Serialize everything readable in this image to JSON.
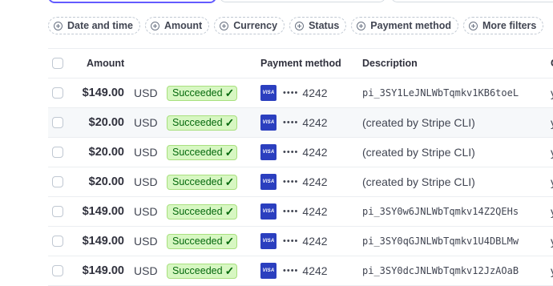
{
  "filters": [
    {
      "label": "Date and time",
      "name": "filter-date-and-time"
    },
    {
      "label": "Amount",
      "name": "filter-amount"
    },
    {
      "label": "Currency",
      "name": "filter-currency"
    },
    {
      "label": "Status",
      "name": "filter-status"
    },
    {
      "label": "Payment method",
      "name": "filter-payment-method"
    },
    {
      "label": "More filters",
      "name": "filter-more-filters"
    }
  ],
  "table": {
    "headers": {
      "amount": "Amount",
      "payment_method": "Payment method",
      "description": "Description",
      "next": "C"
    },
    "rows": [
      {
        "amount": "$149.00",
        "currency": "USD",
        "status": "Succeeded",
        "brand": "VISA",
        "dots": "••••",
        "last4": "4242",
        "description": "pi_3SY1LeJNLWbTqmkv1KB6toeL",
        "mono": true,
        "next": "y"
      },
      {
        "amount": "$20.00",
        "currency": "USD",
        "status": "Succeeded",
        "brand": "VISA",
        "dots": "••••",
        "last4": "4242",
        "description": "(created by Stripe CLI)",
        "mono": false,
        "next": "y"
      },
      {
        "amount": "$20.00",
        "currency": "USD",
        "status": "Succeeded",
        "brand": "VISA",
        "dots": "••••",
        "last4": "4242",
        "description": "(created by Stripe CLI)",
        "mono": false,
        "next": "y"
      },
      {
        "amount": "$20.00",
        "currency": "USD",
        "status": "Succeeded",
        "brand": "VISA",
        "dots": "••••",
        "last4": "4242",
        "description": "(created by Stripe CLI)",
        "mono": false,
        "next": "y"
      },
      {
        "amount": "$149.00",
        "currency": "USD",
        "status": "Succeeded",
        "brand": "VISA",
        "dots": "••••",
        "last4": "4242",
        "description": "pi_3SY0w6JNLWbTqmkv14Z2QEHs",
        "mono": true,
        "next": "y"
      },
      {
        "amount": "$149.00",
        "currency": "USD",
        "status": "Succeeded",
        "brand": "VISA",
        "dots": "••••",
        "last4": "4242",
        "description": "pi_3SY0qGJNLWbTqmkv1U4DBLMw",
        "mono": true,
        "next": "y"
      },
      {
        "amount": "$149.00",
        "currency": "USD",
        "status": "Succeeded",
        "brand": "VISA",
        "dots": "••••",
        "last4": "4242",
        "description": "pi_3SY0dcJNLWbTqmkv12JzAOaB",
        "mono": true,
        "next": "y"
      }
    ],
    "highlighted_row": 1
  },
  "colors": {
    "accent": "#635bff",
    "success_bg": "#d7f7c2",
    "success_text": "#05690d",
    "visa_blue": "#2b3fbf"
  }
}
